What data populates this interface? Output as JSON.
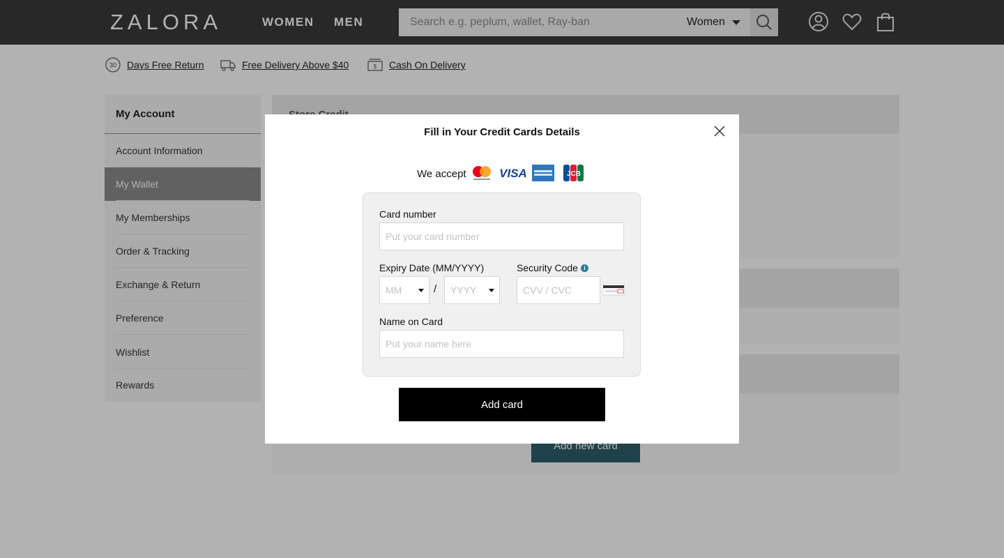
{
  "header": {
    "logo": "ZALORA",
    "nav": [
      {
        "label": "WOMEN"
      },
      {
        "label": "MEN"
      }
    ],
    "search": {
      "placeholder": "Search e.g. peplum, wallet, Ray-ban",
      "category": "Women"
    },
    "icons": [
      "search-icon",
      "account-icon",
      "wishlist-heart-icon",
      "shopping-bag-icon"
    ]
  },
  "perks": [
    {
      "label": "Days Free Return",
      "icon": "30-days-return-icon"
    },
    {
      "label": "Free Delivery Above $40",
      "icon": "delivery-truck-icon"
    },
    {
      "label": "Cash On Delivery",
      "icon": "cash-icon"
    }
  ],
  "sidebar": {
    "title": "My Account",
    "items": [
      {
        "label": "Account Information"
      },
      {
        "label": "My Wallet",
        "active": true
      },
      {
        "label": "My Memberships"
      },
      {
        "label": "Order & Tracking"
      },
      {
        "label": "Exchange & Return"
      },
      {
        "label": "Preference"
      },
      {
        "label": "Wishlist"
      },
      {
        "label": "Rewards"
      }
    ]
  },
  "main": {
    "section_title": "Store Credit",
    "add_new_card_label": "Add new card",
    "accent_color": "#2d5e6a"
  },
  "modal": {
    "title": "Fill in Your Credit Cards Details",
    "accept_label": "We accept",
    "card_brands": [
      "mastercard-icon",
      "visa-icon",
      "amex-icon",
      "jcb-icon"
    ],
    "card_number": {
      "label": "Card number",
      "placeholder": "Put your card number"
    },
    "expiry": {
      "label": "Expiry Date (MM/YYYY)",
      "month_placeholder": "MM",
      "year_placeholder": "YYYY",
      "separator": "/"
    },
    "security": {
      "label": "Security Code",
      "placeholder": "CVV / CVC",
      "info_icon": "info-icon"
    },
    "name": {
      "label": "Name on Card",
      "placeholder": "Put your name here"
    },
    "submit_label": "Add card"
  }
}
